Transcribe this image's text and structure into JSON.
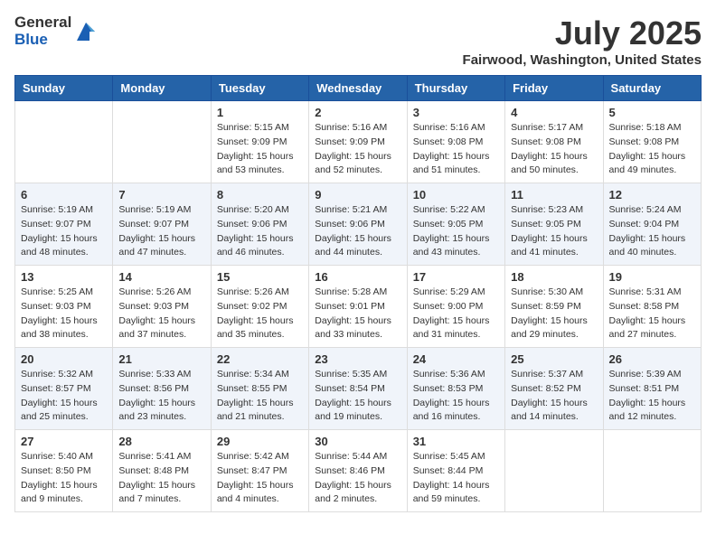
{
  "header": {
    "logo_general": "General",
    "logo_blue": "Blue",
    "month_title": "July 2025",
    "location": "Fairwood, Washington, United States"
  },
  "weekdays": [
    "Sunday",
    "Monday",
    "Tuesday",
    "Wednesday",
    "Thursday",
    "Friday",
    "Saturday"
  ],
  "weeks": [
    [
      {
        "num": "",
        "sunrise": "",
        "sunset": "",
        "daylight": ""
      },
      {
        "num": "",
        "sunrise": "",
        "sunset": "",
        "daylight": ""
      },
      {
        "num": "1",
        "sunrise": "Sunrise: 5:15 AM",
        "sunset": "Sunset: 9:09 PM",
        "daylight": "Daylight: 15 hours and 53 minutes."
      },
      {
        "num": "2",
        "sunrise": "Sunrise: 5:16 AM",
        "sunset": "Sunset: 9:09 PM",
        "daylight": "Daylight: 15 hours and 52 minutes."
      },
      {
        "num": "3",
        "sunrise": "Sunrise: 5:16 AM",
        "sunset": "Sunset: 9:08 PM",
        "daylight": "Daylight: 15 hours and 51 minutes."
      },
      {
        "num": "4",
        "sunrise": "Sunrise: 5:17 AM",
        "sunset": "Sunset: 9:08 PM",
        "daylight": "Daylight: 15 hours and 50 minutes."
      },
      {
        "num": "5",
        "sunrise": "Sunrise: 5:18 AM",
        "sunset": "Sunset: 9:08 PM",
        "daylight": "Daylight: 15 hours and 49 minutes."
      }
    ],
    [
      {
        "num": "6",
        "sunrise": "Sunrise: 5:19 AM",
        "sunset": "Sunset: 9:07 PM",
        "daylight": "Daylight: 15 hours and 48 minutes."
      },
      {
        "num": "7",
        "sunrise": "Sunrise: 5:19 AM",
        "sunset": "Sunset: 9:07 PM",
        "daylight": "Daylight: 15 hours and 47 minutes."
      },
      {
        "num": "8",
        "sunrise": "Sunrise: 5:20 AM",
        "sunset": "Sunset: 9:06 PM",
        "daylight": "Daylight: 15 hours and 46 minutes."
      },
      {
        "num": "9",
        "sunrise": "Sunrise: 5:21 AM",
        "sunset": "Sunset: 9:06 PM",
        "daylight": "Daylight: 15 hours and 44 minutes."
      },
      {
        "num": "10",
        "sunrise": "Sunrise: 5:22 AM",
        "sunset": "Sunset: 9:05 PM",
        "daylight": "Daylight: 15 hours and 43 minutes."
      },
      {
        "num": "11",
        "sunrise": "Sunrise: 5:23 AM",
        "sunset": "Sunset: 9:05 PM",
        "daylight": "Daylight: 15 hours and 41 minutes."
      },
      {
        "num": "12",
        "sunrise": "Sunrise: 5:24 AM",
        "sunset": "Sunset: 9:04 PM",
        "daylight": "Daylight: 15 hours and 40 minutes."
      }
    ],
    [
      {
        "num": "13",
        "sunrise": "Sunrise: 5:25 AM",
        "sunset": "Sunset: 9:03 PM",
        "daylight": "Daylight: 15 hours and 38 minutes."
      },
      {
        "num": "14",
        "sunrise": "Sunrise: 5:26 AM",
        "sunset": "Sunset: 9:03 PM",
        "daylight": "Daylight: 15 hours and 37 minutes."
      },
      {
        "num": "15",
        "sunrise": "Sunrise: 5:26 AM",
        "sunset": "Sunset: 9:02 PM",
        "daylight": "Daylight: 15 hours and 35 minutes."
      },
      {
        "num": "16",
        "sunrise": "Sunrise: 5:28 AM",
        "sunset": "Sunset: 9:01 PM",
        "daylight": "Daylight: 15 hours and 33 minutes."
      },
      {
        "num": "17",
        "sunrise": "Sunrise: 5:29 AM",
        "sunset": "Sunset: 9:00 PM",
        "daylight": "Daylight: 15 hours and 31 minutes."
      },
      {
        "num": "18",
        "sunrise": "Sunrise: 5:30 AM",
        "sunset": "Sunset: 8:59 PM",
        "daylight": "Daylight: 15 hours and 29 minutes."
      },
      {
        "num": "19",
        "sunrise": "Sunrise: 5:31 AM",
        "sunset": "Sunset: 8:58 PM",
        "daylight": "Daylight: 15 hours and 27 minutes."
      }
    ],
    [
      {
        "num": "20",
        "sunrise": "Sunrise: 5:32 AM",
        "sunset": "Sunset: 8:57 PM",
        "daylight": "Daylight: 15 hours and 25 minutes."
      },
      {
        "num": "21",
        "sunrise": "Sunrise: 5:33 AM",
        "sunset": "Sunset: 8:56 PM",
        "daylight": "Daylight: 15 hours and 23 minutes."
      },
      {
        "num": "22",
        "sunrise": "Sunrise: 5:34 AM",
        "sunset": "Sunset: 8:55 PM",
        "daylight": "Daylight: 15 hours and 21 minutes."
      },
      {
        "num": "23",
        "sunrise": "Sunrise: 5:35 AM",
        "sunset": "Sunset: 8:54 PM",
        "daylight": "Daylight: 15 hours and 19 minutes."
      },
      {
        "num": "24",
        "sunrise": "Sunrise: 5:36 AM",
        "sunset": "Sunset: 8:53 PM",
        "daylight": "Daylight: 15 hours and 16 minutes."
      },
      {
        "num": "25",
        "sunrise": "Sunrise: 5:37 AM",
        "sunset": "Sunset: 8:52 PM",
        "daylight": "Daylight: 15 hours and 14 minutes."
      },
      {
        "num": "26",
        "sunrise": "Sunrise: 5:39 AM",
        "sunset": "Sunset: 8:51 PM",
        "daylight": "Daylight: 15 hours and 12 minutes."
      }
    ],
    [
      {
        "num": "27",
        "sunrise": "Sunrise: 5:40 AM",
        "sunset": "Sunset: 8:50 PM",
        "daylight": "Daylight: 15 hours and 9 minutes."
      },
      {
        "num": "28",
        "sunrise": "Sunrise: 5:41 AM",
        "sunset": "Sunset: 8:48 PM",
        "daylight": "Daylight: 15 hours and 7 minutes."
      },
      {
        "num": "29",
        "sunrise": "Sunrise: 5:42 AM",
        "sunset": "Sunset: 8:47 PM",
        "daylight": "Daylight: 15 hours and 4 minutes."
      },
      {
        "num": "30",
        "sunrise": "Sunrise: 5:44 AM",
        "sunset": "Sunset: 8:46 PM",
        "daylight": "Daylight: 15 hours and 2 minutes."
      },
      {
        "num": "31",
        "sunrise": "Sunrise: 5:45 AM",
        "sunset": "Sunset: 8:44 PM",
        "daylight": "Daylight: 14 hours and 59 minutes."
      },
      {
        "num": "",
        "sunrise": "",
        "sunset": "",
        "daylight": ""
      },
      {
        "num": "",
        "sunrise": "",
        "sunset": "",
        "daylight": ""
      }
    ]
  ]
}
